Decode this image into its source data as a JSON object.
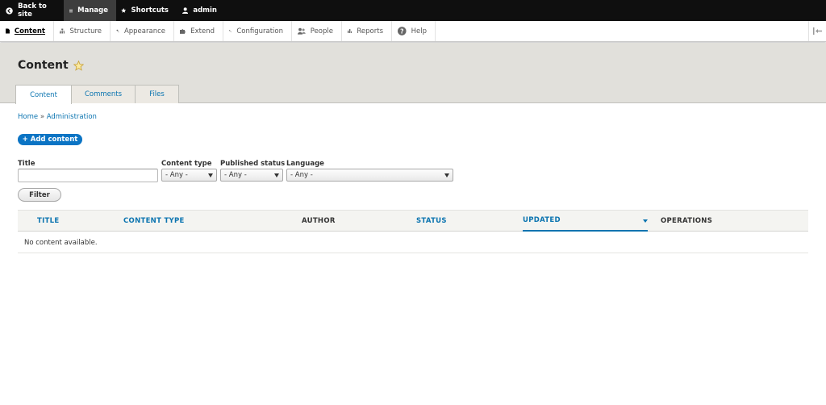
{
  "toolbar": {
    "back_label": "Back to site",
    "manage_label": "Manage",
    "shortcuts_label": "Shortcuts",
    "user_label": "admin"
  },
  "tray": {
    "items": [
      {
        "label": "Content",
        "icon": "file-icon"
      },
      {
        "label": "Structure",
        "icon": "sitemap-icon"
      },
      {
        "label": "Appearance",
        "icon": "paint-icon"
      },
      {
        "label": "Extend",
        "icon": "puzzle-icon"
      },
      {
        "label": "Configuration",
        "icon": "wrench-icon"
      },
      {
        "label": "People",
        "icon": "people-icon"
      },
      {
        "label": "Reports",
        "icon": "bar-chart-icon"
      },
      {
        "label": "Help",
        "icon": "help-icon"
      }
    ]
  },
  "page": {
    "title": "Content",
    "tabs": [
      "Content",
      "Comments",
      "Files"
    ]
  },
  "breadcrumb": {
    "home": "Home",
    "separator": "»",
    "current": "Administration"
  },
  "actions": {
    "add_content": "+ Add content"
  },
  "filters": {
    "title_label": "Title",
    "title_value": "",
    "content_type_label": "Content type",
    "content_type_value": "- Any -",
    "status_label": "Published status",
    "status_value": "- Any -",
    "language_label": "Language",
    "language_value": "- Any -",
    "filter_button": "Filter"
  },
  "table": {
    "columns": [
      "TITLE",
      "CONTENT TYPE",
      "AUTHOR",
      "STATUS",
      "UPDATED",
      "OPERATIONS"
    ],
    "empty_message": "No content available."
  },
  "colors": {
    "toolbar_bg": "#0f0f0f",
    "header_bg": "#e1e0db",
    "link": "#0b74b0",
    "primary_button": "#0b74c4"
  }
}
